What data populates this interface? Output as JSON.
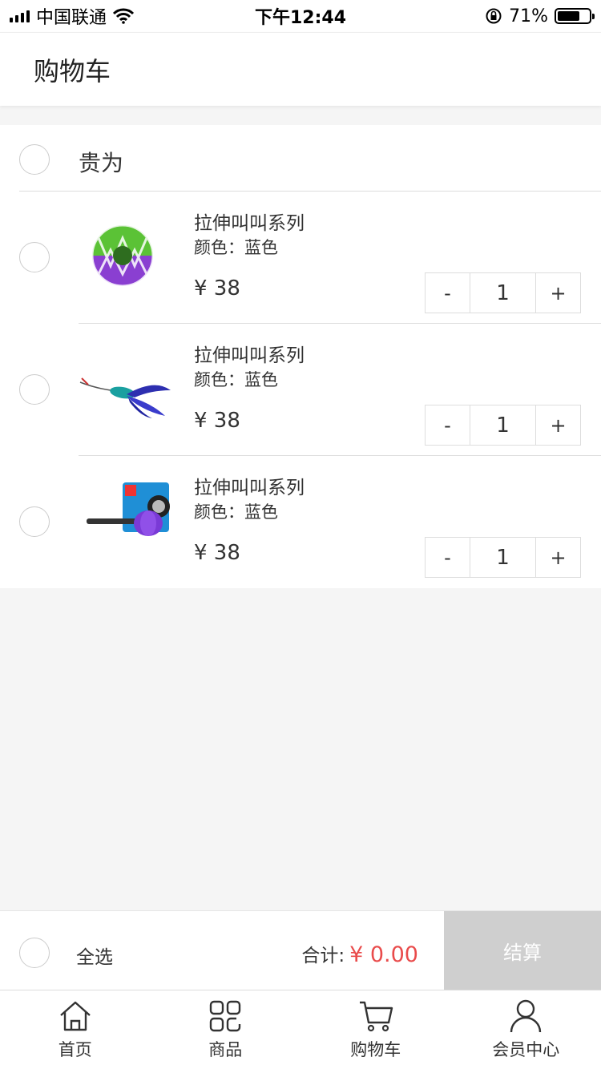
{
  "status_bar": {
    "carrier": "中国联通",
    "time": "下午12:44",
    "battery": "71%",
    "battery_level": 0.71
  },
  "header": {
    "title": "购物车"
  },
  "cart": {
    "store_name": "贵为",
    "items": [
      {
        "title": "拉伸叫叫系列",
        "color": "颜色：蓝色",
        "price": "¥ 38",
        "qty": "1",
        "image": "green-purple-ball-toy"
      },
      {
        "title": "拉伸叫叫系列",
        "color": "颜色：蓝色",
        "price": "¥ 38",
        "qty": "1",
        "image": "feather-wand-toy"
      },
      {
        "title": "拉伸叫叫系列",
        "color": "颜色：蓝色",
        "price": "¥ 38",
        "qty": "1",
        "image": "push-to-mute-toy"
      }
    ],
    "minus_label": "-",
    "plus_label": "+"
  },
  "checkout": {
    "select_all": "全选",
    "total_label": "合计:",
    "total_value": "¥ 0.00",
    "settle_label": "结算",
    "accent_color": "#e94b4b"
  },
  "tabs": [
    {
      "label": "首页",
      "icon": "home-icon"
    },
    {
      "label": "商品",
      "icon": "grid-icon"
    },
    {
      "label": "购物车",
      "icon": "cart-icon"
    },
    {
      "label": "会员中心",
      "icon": "user-icon"
    }
  ]
}
